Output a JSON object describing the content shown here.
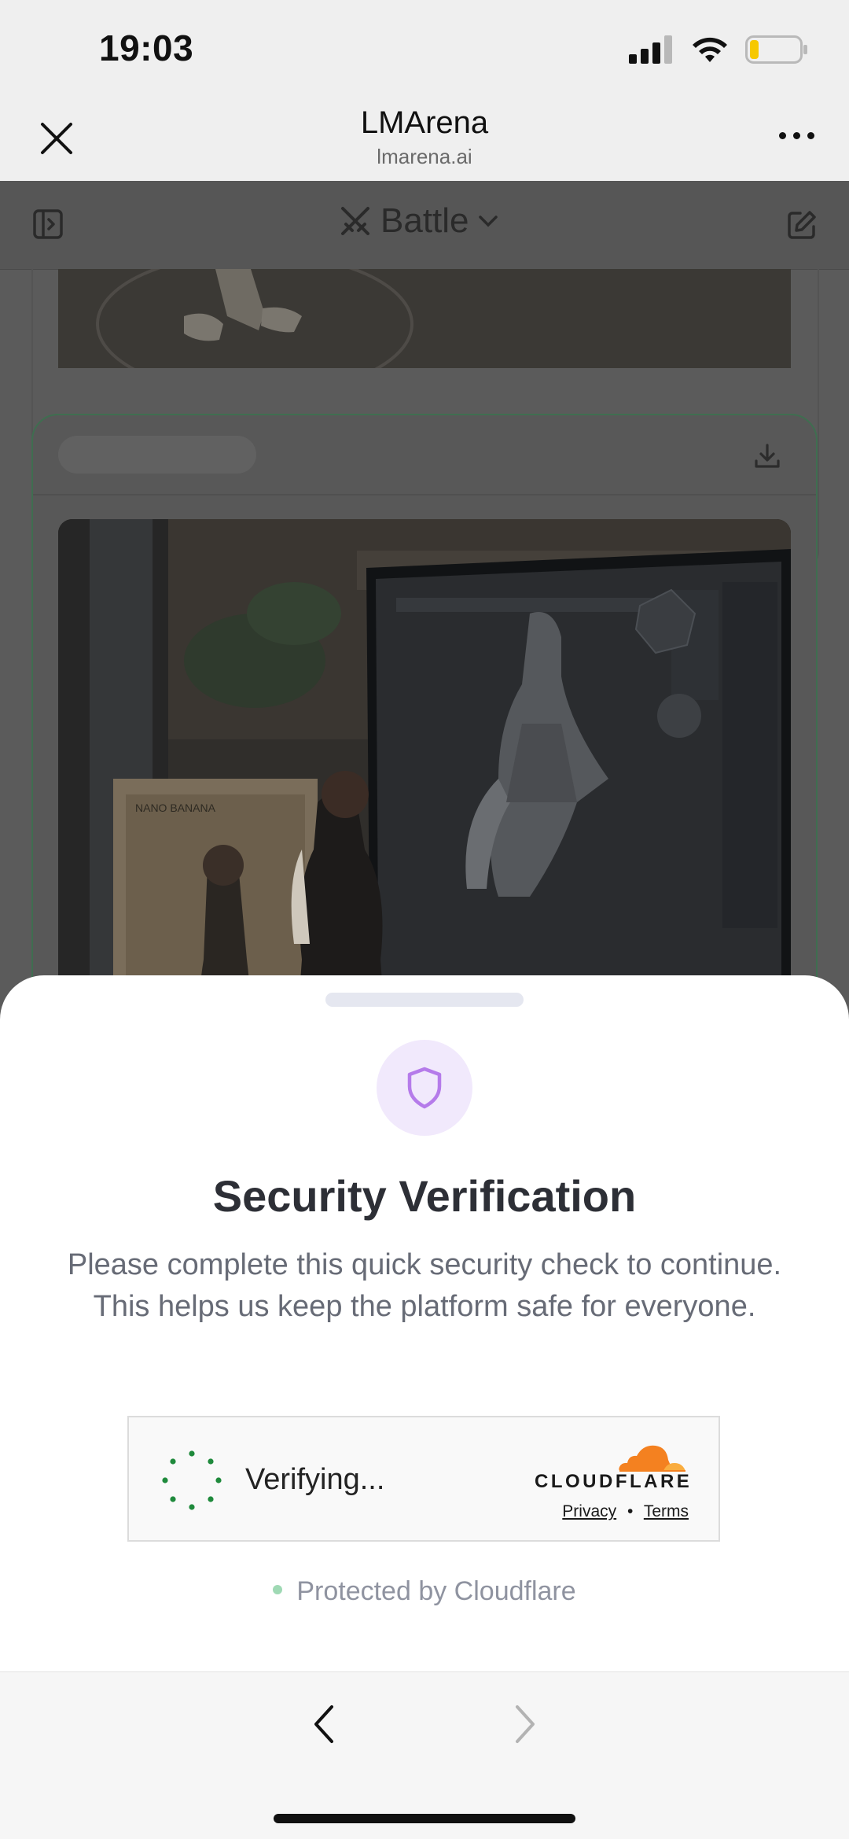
{
  "status_bar": {
    "time": "19:03",
    "icons": [
      "signal-icon",
      "wifi-icon",
      "battery-icon"
    ],
    "battery_level": 0.18
  },
  "browser": {
    "title": "LMArena",
    "url": "lmarena.ai",
    "icons": [
      "close-icon",
      "more-icon"
    ]
  },
  "app": {
    "mode_label": "Battle",
    "icons": [
      "sidebar-toggle-icon",
      "swords-icon",
      "chevron-down-icon",
      "new-chat-icon",
      "download-icon"
    ],
    "accent_border": "#3f6e50",
    "photo_text": "NANO BANANA"
  },
  "sheet": {
    "title": "Security Verification",
    "description": "Please complete this quick security check to continue. This helps us keep the platform safe for everyone.",
    "icon": "shield-icon",
    "icon_color": "#b57bea",
    "turnstile": {
      "status": "Verifying...",
      "brand": "CLOUDFLARE",
      "privacy_link": "Privacy",
      "separator": "•",
      "terms_link": "Terms",
      "spinner_color": "#1f8a3c",
      "brand_orange": "#f48120"
    },
    "footer": "Protected by Cloudflare"
  },
  "toolbar": {
    "icons": [
      "back-icon",
      "forward-icon"
    ],
    "forward_enabled": false
  }
}
